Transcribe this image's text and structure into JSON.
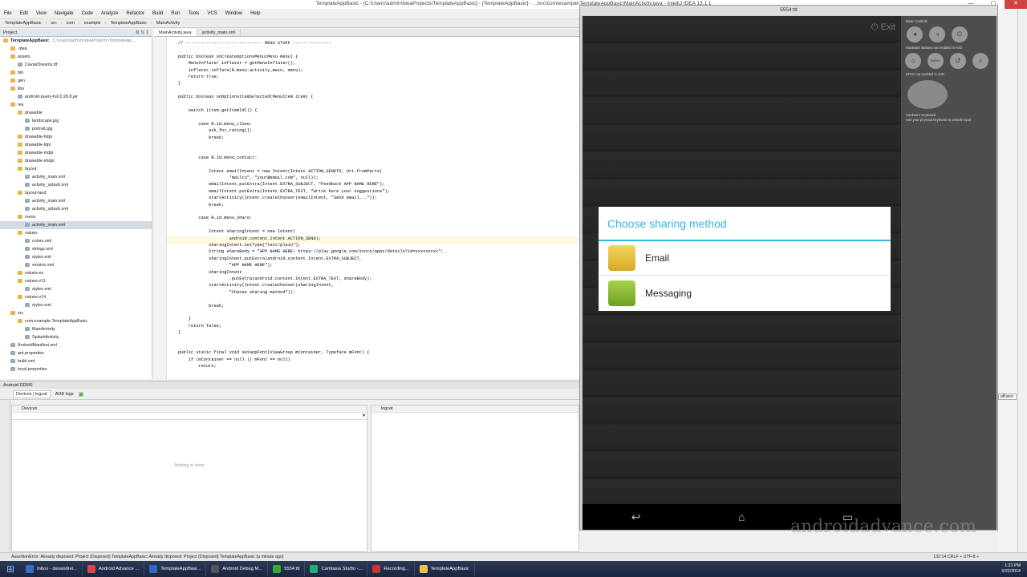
{
  "window": {
    "title": "TemplateAppBasic - [C:\\Users\\admin\\IdeaProjects\\TemplateAppBasic] - [TemplateAppBasic] - ...\\src\\com\\example\\TemplateAppBasic\\MainActivity.java - IntelliJ IDEA 13.1.1"
  },
  "menu": [
    "File",
    "Edit",
    "View",
    "Navigate",
    "Code",
    "Analyze",
    "Refactor",
    "Build",
    "Run",
    "Tools",
    "VCS",
    "Window",
    "Help"
  ],
  "breadcrumbs": [
    "TemplateAppBasic",
    "src",
    "com",
    "example",
    "TemplateAppBasic",
    "MainActivity"
  ],
  "project_panel": {
    "title": "Project",
    "root": "TemplateAppBasic",
    "root_path": "C:\\Users\\admin\\IdeaProjects\\TemplateAp..."
  },
  "tree": [
    {
      "label": ".idea",
      "depth": 1,
      "type": "folder"
    },
    {
      "label": "assets",
      "depth": 1,
      "type": "folder"
    },
    {
      "label": "CaviarDreams.ttf",
      "depth": 2,
      "type": "file"
    },
    {
      "label": "bin",
      "depth": 1,
      "type": "folder"
    },
    {
      "label": "gen",
      "depth": 1,
      "type": "folder"
    },
    {
      "label": "libs",
      "depth": 1,
      "type": "folder"
    },
    {
      "label": "android-query-full.0.26.8.jar",
      "depth": 2,
      "type": "file"
    },
    {
      "label": "res",
      "depth": 1,
      "type": "folder"
    },
    {
      "label": "drawable",
      "depth": 2,
      "type": "folder"
    },
    {
      "label": "landscape.jpg",
      "depth": 3,
      "type": "file"
    },
    {
      "label": "portrait.jpg",
      "depth": 3,
      "type": "file"
    },
    {
      "label": "drawable-hdpi",
      "depth": 2,
      "type": "folder"
    },
    {
      "label": "drawable-ldpi",
      "depth": 2,
      "type": "folder"
    },
    {
      "label": "drawable-mdpi",
      "depth": 2,
      "type": "folder"
    },
    {
      "label": "drawable-xhdpi",
      "depth": 2,
      "type": "folder"
    },
    {
      "label": "layout",
      "depth": 2,
      "type": "folder"
    },
    {
      "label": "activity_main.xml",
      "depth": 3,
      "type": "file"
    },
    {
      "label": "activity_splash.xml",
      "depth": 3,
      "type": "file"
    },
    {
      "label": "layout-land",
      "depth": 2,
      "type": "folder"
    },
    {
      "label": "activity_main.xml",
      "depth": 3,
      "type": "file"
    },
    {
      "label": "activity_splash.xml",
      "depth": 3,
      "type": "file"
    },
    {
      "label": "menu",
      "depth": 2,
      "type": "folder"
    },
    {
      "label": "activity_main.xml",
      "depth": 3,
      "type": "file",
      "selected": true
    },
    {
      "label": "values",
      "depth": 2,
      "type": "folder"
    },
    {
      "label": "colors.xml",
      "depth": 3,
      "type": "file"
    },
    {
      "label": "strings.xml",
      "depth": 3,
      "type": "file"
    },
    {
      "label": "styles.xml",
      "depth": 3,
      "type": "file"
    },
    {
      "label": "version.xml",
      "depth": 3,
      "type": "file"
    },
    {
      "label": "values-es",
      "depth": 2,
      "type": "folder"
    },
    {
      "label": "values-v11",
      "depth": 2,
      "type": "folder"
    },
    {
      "label": "styles.xml",
      "depth": 3,
      "type": "file"
    },
    {
      "label": "values-v14",
      "depth": 2,
      "type": "folder"
    },
    {
      "label": "styles.xml",
      "depth": 3,
      "type": "file"
    },
    {
      "label": "src",
      "depth": 1,
      "type": "folder"
    },
    {
      "label": "com.example.TemplateAppBasic",
      "depth": 2,
      "type": "folder"
    },
    {
      "label": "MainActivity",
      "depth": 3,
      "type": "file"
    },
    {
      "label": "SplashActivity",
      "depth": 3,
      "type": "file"
    },
    {
      "label": "AndroidManifest.xml",
      "depth": 1,
      "type": "file"
    },
    {
      "label": "ant.properties",
      "depth": 1,
      "type": "file"
    },
    {
      "label": "build.xml",
      "depth": 1,
      "type": "file"
    },
    {
      "label": "local.properties",
      "depth": 1,
      "type": "file"
    }
  ],
  "editor_tabs": [
    {
      "label": "MainActivity.java",
      "active": true
    },
    {
      "label": "activity_main.xml",
      "active": false
    }
  ],
  "code_lines": [
    "// ------------------------------ MENU STUFF ---------------",
    "",
    "public boolean onCreateOptionsMenu(Menu menu) {",
    "    MenuInflater inflater = getMenuInflater();",
    "    inflater.inflate(R.menu.activity_main, menu);",
    "    return true;",
    "}",
    "",
    "public boolean onOptionsItemSelected(MenuItem item) {",
    "",
    "    switch (item.getItemId()) {",
    "",
    "        case R.id.menu_close:",
    "            ask_for_rating();",
    "            break;",
    "",
    "",
    "        case R.id.menu_contact:",
    "",
    "            Intent emailIntent = new Intent(Intent.ACTION_SENDTO, Uri.fromParts(",
    "                    \"mailto\", \"your@email.com\", null));",
    "            emailIntent.putExtra(Intent.EXTRA_SUBJECT, \"Feedback APP NAME HERE\");",
    "            emailIntent.putExtra(Intent.EXTRA_TEXT, \"Write here your suggestions\");",
    "            startActivity(Intent.createChooser(emailIntent, \"Send email...\"));",
    "            break;",
    "",
    "        case R.id.menu_share:",
    "",
    "            Intent sharingIntent = new Intent(",
    "                    android.content.Intent.ACTION_SEND);",
    "            sharingIntent.setType(\"text/plain\");",
    "            String shareBody = \"APP NAME HERE! https://play.google.com/store/apps/details?id=xxxxxxxxx\";",
    "            sharingIntent.putExtra(android.content.Intent.EXTRA_SUBJECT,",
    "                    \"APP NAME HERE\");",
    "            sharingIntent",
    "                    .putExtra(android.content.Intent.EXTRA_TEXT, shareBody);",
    "            startActivity(Intent.createChooser(sharingIntent,",
    "                    \"Choose sharing method\"));",
    "",
    "            break;",
    "",
    "    }",
    "    return false;",
    "}",
    "",
    "",
    "public static final void setAppFont(ViewGroup mContainer, Typeface mFont) {",
    "    if (mContainer == null || mFont == null)",
    "        return;"
  ],
  "bottom": {
    "header": "Android DDMS",
    "tabs": [
      "Devices | logcat",
      "ADB logs"
    ],
    "devices_title": "Devices",
    "logcat_title": "logcat",
    "empty_text": "Nothing to show"
  },
  "status": {
    "message": "AssertionError: Already disposed: Project (Disposed) TemplateAppBasic: Already disposed: Project (Disposed) TemplateAppBasic (a minute ago)",
    "right": "132:14   CRLF ÷  UTF-8 ÷"
  },
  "taskbar": [
    {
      "label": "Inbox - danandrei...",
      "color": "#3b6cc4"
    },
    {
      "label": "Android Advance ...",
      "color": "#d44"
    },
    {
      "label": "TemplateAppBasi...",
      "color": "#2c6ebd"
    },
    {
      "label": "Android Debug M...",
      "color": "#555"
    },
    {
      "label": "5554:ttt",
      "color": "#3a3"
    },
    {
      "label": "Camtasia Studio -...",
      "color": "#2a7"
    },
    {
      "label": "Recording...",
      "color": "#c33"
    },
    {
      "label": "TemplateAppBasic",
      "color": "#e8c34a"
    }
  ],
  "clock": {
    "time": "1:21 PM",
    "date": "5/22/2014"
  },
  "emulator": {
    "title": "5554:ttt",
    "exit_label": "Exit",
    "dialog": {
      "title": "Choose sharing method",
      "items": [
        {
          "label": "Email",
          "color": "#e8c43a"
        },
        {
          "label": "Messaging",
          "color": "#9bc33a"
        }
      ]
    },
    "panel": {
      "basic_controls": "Basic Controls",
      "hw_buttons": "Hardware Buttons not enabled in AVD",
      "dpad": "DPAD not enabled in AVD",
      "keyboard": "Hardware Keyboard",
      "keyboard_hint": "Use your physical keyboard to provide input",
      "menu_label": "MENU"
    }
  },
  "watermark": "androidadvance.com",
  "right_fragment": "pBasic"
}
